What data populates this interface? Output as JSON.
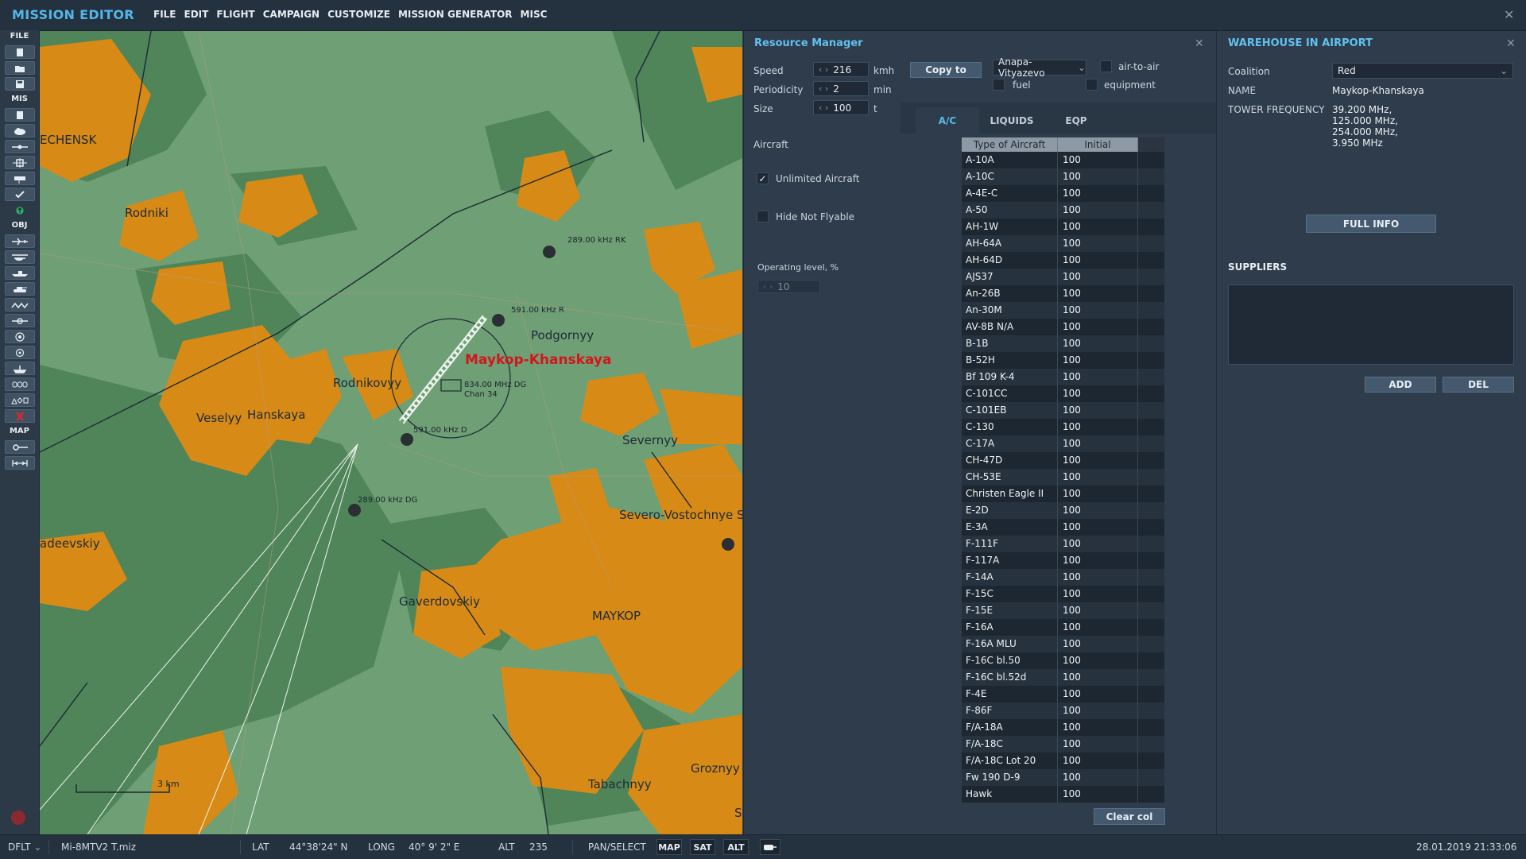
{
  "app": {
    "title": "MISSION EDITOR",
    "close_icon": "close-icon"
  },
  "menu": [
    "FILE",
    "EDIT",
    "FLIGHT",
    "CAMPAIGN",
    "CUSTOMIZE",
    "MISSION GENERATOR",
    "MISC"
  ],
  "toolbar": {
    "file_label": "FILE",
    "mis_label": "MIS",
    "obj_label": "OBJ",
    "map_label": "MAP"
  },
  "map": {
    "airfield": "Maykop-Khanskaya",
    "towns": [
      "ECHENSK",
      "Rodniki",
      "Podgornyy",
      "Rodnikovyy",
      "Veselyy",
      "Hanskaya",
      "Severnyy",
      "Severo-Vostochnye S",
      "adeevskiy",
      "Gaverdovskiy",
      "MAYKOP",
      "Tabachnyy",
      "Groznyy",
      "S"
    ],
    "beacons": [
      "289.00 kHz RK",
      "591.00 kHz R",
      "834.00 MHz DG",
      "Chan 34",
      "591.00 kHz D",
      "289.00 kHz DG"
    ],
    "scale_label": "3 km",
    "colors": {
      "land": "#6f9f74",
      "forest": "#4f8559",
      "urban": "#d88a16",
      "airfield": "#d3161c"
    }
  },
  "resource_manager": {
    "title": "Resource Manager",
    "speed_label": "Speed",
    "speed_value": "216",
    "speed_unit": "kmh",
    "periodicity_label": "Periodicity",
    "periodicity_value": "2",
    "periodicity_unit": "min",
    "size_label": "Size",
    "size_value": "100",
    "size_unit": "t",
    "copy_button": "Copy to",
    "airport_select": "Anapa-Vityazevo",
    "air_to_air_label": "air-to-air",
    "fuel_label": "fuel",
    "equipment_label": "equipment",
    "tabs": [
      "A/C",
      "LIQUIDS",
      "EQP"
    ],
    "aircraft_label": "Aircraft",
    "unlimited_label": "Unlimited Aircraft",
    "unlimited_checked": true,
    "hide_not_flyable_label": "Hide Not Flyable",
    "operating_level_label": "Operating level, %",
    "operating_level_value": "10",
    "table_headers": [
      "Type of Aircraft",
      "Initial"
    ],
    "rows": [
      [
        "A-10A",
        "100"
      ],
      [
        "A-10C",
        "100"
      ],
      [
        "A-4E-C",
        "100"
      ],
      [
        "A-50",
        "100"
      ],
      [
        "AH-1W",
        "100"
      ],
      [
        "AH-64A",
        "100"
      ],
      [
        "AH-64D",
        "100"
      ],
      [
        "AJS37",
        "100"
      ],
      [
        "An-26B",
        "100"
      ],
      [
        "An-30M",
        "100"
      ],
      [
        "AV-8B N/A",
        "100"
      ],
      [
        "B-1B",
        "100"
      ],
      [
        "B-52H",
        "100"
      ],
      [
        "Bf 109 K-4",
        "100"
      ],
      [
        "C-101CC",
        "100"
      ],
      [
        "C-101EB",
        "100"
      ],
      [
        "C-130",
        "100"
      ],
      [
        "C-17A",
        "100"
      ],
      [
        "CH-47D",
        "100"
      ],
      [
        "CH-53E",
        "100"
      ],
      [
        "Christen Eagle II",
        "100"
      ],
      [
        "E-2D",
        "100"
      ],
      [
        "E-3A",
        "100"
      ],
      [
        "F-111F",
        "100"
      ],
      [
        "F-117A",
        "100"
      ],
      [
        "F-14A",
        "100"
      ],
      [
        "F-15C",
        "100"
      ],
      [
        "F-15E",
        "100"
      ],
      [
        "F-16A",
        "100"
      ],
      [
        "F-16A MLU",
        "100"
      ],
      [
        "F-16C bl.50",
        "100"
      ],
      [
        "F-16C bl.52d",
        "100"
      ],
      [
        "F-4E",
        "100"
      ],
      [
        "F-86F",
        "100"
      ],
      [
        "F/A-18A",
        "100"
      ],
      [
        "F/A-18C",
        "100"
      ],
      [
        "F/A-18C Lot 20",
        "100"
      ],
      [
        "Fw 190 D-9",
        "100"
      ],
      [
        "Hawk",
        "100"
      ]
    ],
    "clear_col_button": "Clear col"
  },
  "warehouse": {
    "title": "WAREHOUSE IN AIRPORT",
    "coalition_label": "Coalition",
    "coalition_value": "Red",
    "name_label": "NAME",
    "name_value": "Maykop-Khanskaya",
    "tower_label": "TOWER FREQUENCY",
    "tower_lines": [
      "39.200 MHz,",
      "125.000 MHz,",
      "254.000 MHz,",
      "3.950 MHz"
    ],
    "full_info_button": "FULL INFO",
    "suppliers_label": "SUPPLIERS",
    "add_button": "ADD",
    "del_button": "DEL"
  },
  "status": {
    "profile": "DFLT",
    "file": "Mi-8MTV2 T.miz",
    "lat_label": "LAT",
    "lat_value": "44°38'24\" N",
    "long_label": "LONG",
    "long_value": "40° 9' 2\" E",
    "alt_label": "ALT",
    "alt_value": "235",
    "mode_label": "PAN/SELECT",
    "map_button": "MAP",
    "sat_button": "SAT",
    "alt_button": "ALT",
    "datetime": "28.01.2019 21:33:06"
  }
}
